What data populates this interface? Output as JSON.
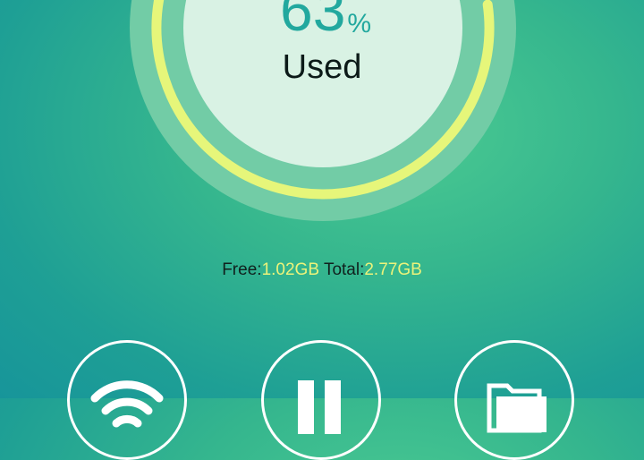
{
  "storage": {
    "used_percent": 63,
    "percent_value": "63",
    "percent_sign": "%",
    "used_label": "Used",
    "free_label": "Free:",
    "free_value": "1.02GB",
    "total_label": "Total:",
    "total_value": "2.77GB"
  },
  "colors": {
    "accent_arc": "#e6f67a",
    "percent_text": "#22a89e",
    "value_text": "#ecf37a"
  },
  "actions": [
    {
      "icon": "wifi-icon"
    },
    {
      "icon": "pause-icon"
    },
    {
      "icon": "folder-icon"
    }
  ]
}
